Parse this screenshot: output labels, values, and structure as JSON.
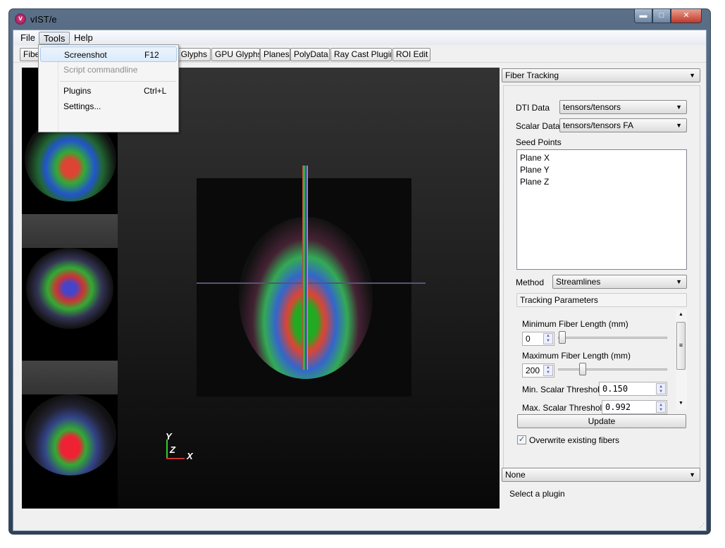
{
  "window": {
    "title": "vIST/e",
    "icon": "app-logo-icon",
    "controls": [
      "minimize",
      "maximize",
      "close"
    ]
  },
  "menubar": {
    "items": [
      {
        "label": "File"
      },
      {
        "label": "Tools"
      },
      {
        "label": "Help"
      }
    ]
  },
  "tools_menu": {
    "items": [
      {
        "label": "Screenshot",
        "shortcut": "F12",
        "highlighted": true
      },
      {
        "label": "Script commandline",
        "disabled": true
      },
      {
        "label": "Plugins",
        "shortcut": "Ctrl+L"
      },
      {
        "label": "Settings..."
      }
    ]
  },
  "toolbar": {
    "tabs": [
      {
        "label": "Fibe"
      },
      {
        "label": "Glyphs"
      },
      {
        "label": "GPU Glyphs"
      },
      {
        "label": "Planes"
      },
      {
        "label": "PolyData"
      },
      {
        "label": "Ray Cast Plugin"
      },
      {
        "label": "ROI Edit"
      }
    ]
  },
  "viewport": {
    "axes": {
      "y": "Y",
      "z": "Z",
      "x": "X"
    }
  },
  "panel": {
    "plugin_select": "Fiber Tracking",
    "dti_label": "DTI Data",
    "dti_value": "tensors/tensors",
    "scalar_label": "Scalar Data",
    "scalar_value": "tensors/tensors FA",
    "seed_label": "Seed Points",
    "seeds": [
      "Plane X",
      "Plane Y",
      "Plane Z"
    ],
    "method_label": "Method",
    "method_value": "Streamlines",
    "params_header": "Tracking Parameters",
    "min_len_label": "Minimum Fiber Length (mm)",
    "min_len_value": "0",
    "max_len_label": "Maximum Fiber Length (mm)",
    "max_len_value": "200",
    "min_thr_label": "Min. Scalar Threshold",
    "min_thr_value": "0.150",
    "max_thr_label": "Max. Scalar Threshold",
    "max_thr_value": "0.992",
    "update_label": "Update",
    "overwrite_label": "Overwrite existing fibers",
    "overwrite_checked": true,
    "bottom_select": "None",
    "bottom_hint": "Select a plugin"
  }
}
